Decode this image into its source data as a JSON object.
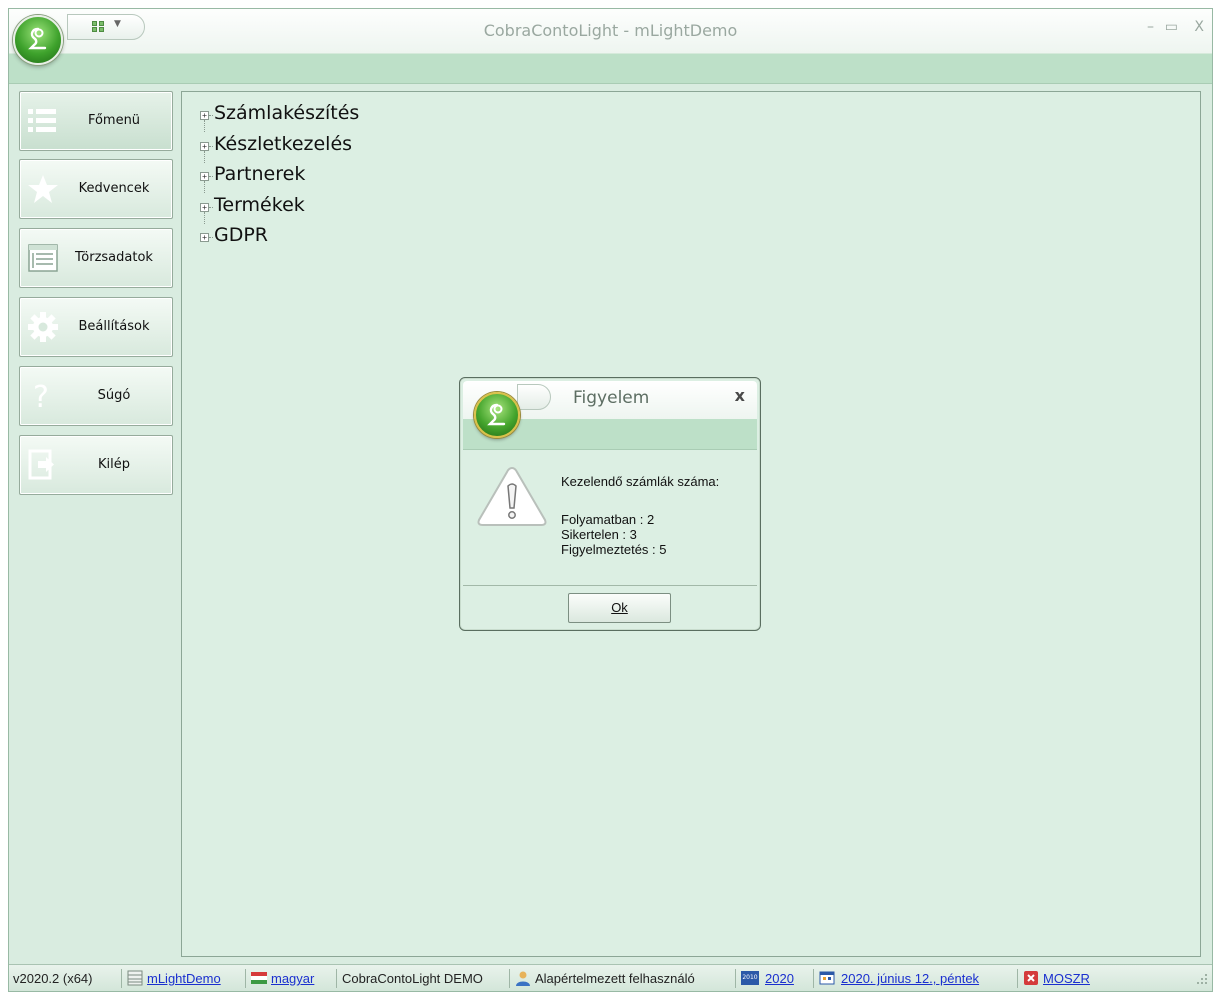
{
  "window": {
    "title": "CobraContoLight - mLightDemo",
    "minimize_glyph": "–",
    "maximize_glyph": "▭",
    "close_glyph": "X"
  },
  "sidebar": {
    "items": [
      {
        "label": "Főmenü",
        "icon": "list-icon"
      },
      {
        "label": "Kedvencek",
        "icon": "star-icon"
      },
      {
        "label": "Törzsadatok",
        "icon": "table-icon"
      },
      {
        "label": "Beállítások",
        "icon": "gear-icon"
      },
      {
        "label": "Súgó",
        "icon": "question-icon"
      },
      {
        "label": "Kilép",
        "icon": "exit-icon"
      }
    ]
  },
  "tree": {
    "items": [
      {
        "label": "Számlakészítés"
      },
      {
        "label": "Készletkezelés"
      },
      {
        "label": "Partnerek"
      },
      {
        "label": "Termékek"
      },
      {
        "label": "GDPR"
      }
    ],
    "expand_glyph": "+"
  },
  "dialog": {
    "title": "Figyelem",
    "close_glyph": "x",
    "heading": "Kezelendő számlák száma:",
    "line1": "Folyamatban : 2",
    "line2": "Sikertelen : 3",
    "line3": "Figyelmeztetés : 5",
    "ok_label": "Ok",
    "icon": "warning-icon"
  },
  "statusbar": {
    "version": "v2020.2 (x64)",
    "database": "mLightDemo",
    "language": "magyar",
    "product": "CobraContoLight DEMO",
    "user": "Alapértelmezett felhasználó",
    "year_label": "2020",
    "year_icon_text": "2010",
    "date": "2020. június 12., péntek",
    "moszr": "MOSZR"
  },
  "colors": {
    "accent_green": "#bde0c8",
    "panel_bg": "#dcefe3",
    "link_blue": "#1a2fcf"
  }
}
